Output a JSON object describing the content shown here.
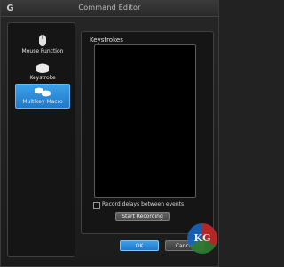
{
  "window": {
    "title": "Command Editor",
    "logo": "G"
  },
  "nav": {
    "items": [
      {
        "label": "Mouse Function",
        "icon": "mouse-icon",
        "active": false
      },
      {
        "label": "Keystroke",
        "icon": "keystroke-icon",
        "active": false
      },
      {
        "label": "Multikey Macro",
        "icon": "multikey-icon",
        "active": true
      }
    ]
  },
  "main": {
    "section_label": "Keystrokes",
    "record_delays_label": "Record delays between events",
    "record_delays_checked": false,
    "start_recording_label": "Start Recording"
  },
  "footer": {
    "ok_label": "OK",
    "cancel_label": "Cancel"
  },
  "watermark": {
    "text": "KG"
  },
  "colors": {
    "accent": "#2a8ede",
    "background": "#222222"
  }
}
